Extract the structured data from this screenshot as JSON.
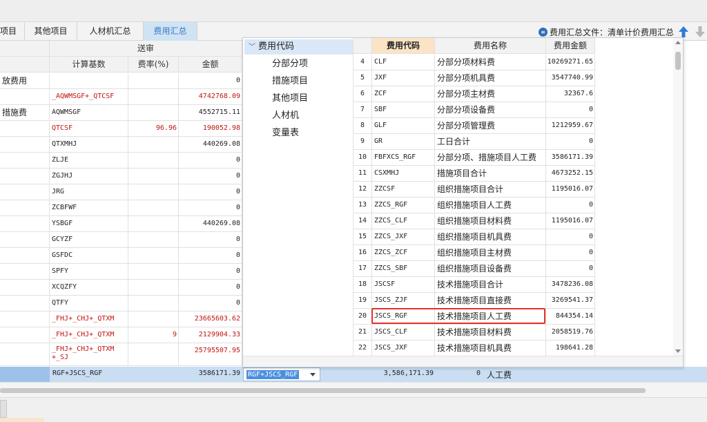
{
  "tabs": [
    {
      "label": "项目"
    },
    {
      "label": "其他项目"
    },
    {
      "label": "人材机汇总"
    },
    {
      "label": "费用汇总",
      "active": true
    }
  ],
  "file_indicator": {
    "icon": "document-icon",
    "label": "费用汇总文件：清单计价费用汇总"
  },
  "left_grid": {
    "group_header": "送审",
    "headers": {
      "basis": "计算基数",
      "rate": "费率(%)",
      "amount": "金额"
    },
    "rows": [
      {
        "name": "放费用",
        "basis": "",
        "rate": "",
        "amount": "0"
      },
      {
        "name": "",
        "basis": "_AQWMSGF+_QTCSF",
        "rate": "",
        "amount": "4742768.09",
        "red": true
      },
      {
        "name": "措施费",
        "basis": "AQWMSGF",
        "rate": "",
        "amount": "4552715.11"
      },
      {
        "name": "",
        "basis": "QTCSF",
        "rate": "96.96",
        "amount": "190052.98",
        "red": true
      },
      {
        "name": "",
        "basis": "QTXMHJ",
        "rate": "",
        "amount": "440269.08"
      },
      {
        "name": "",
        "basis": "ZLJE",
        "rate": "",
        "amount": "0"
      },
      {
        "name": "",
        "basis": "ZGJHJ",
        "rate": "",
        "amount": "0"
      },
      {
        "name": "",
        "basis": "JRG",
        "rate": "",
        "amount": "0"
      },
      {
        "name": "",
        "basis": "ZCBFWF",
        "rate": "",
        "amount": "0"
      },
      {
        "name": "",
        "basis": "YSBGF",
        "rate": "",
        "amount": "440269.08"
      },
      {
        "name": "",
        "basis": "GCYZF",
        "rate": "",
        "amount": "0"
      },
      {
        "name": "",
        "basis": "GSFDC",
        "rate": "",
        "amount": "0"
      },
      {
        "name": "",
        "basis": "SPFY",
        "rate": "",
        "amount": "0"
      },
      {
        "name": "",
        "basis": "XCQZFY",
        "rate": "",
        "amount": "0"
      },
      {
        "name": "",
        "basis": "QTFY",
        "rate": "",
        "amount": "0"
      },
      {
        "name": "",
        "basis": "_FHJ+_CHJ+_QTXM",
        "rate": "",
        "amount": "23665603.62",
        "red": true
      },
      {
        "name": "",
        "basis": "_FHJ+_CHJ+_QTXM",
        "rate": "9",
        "amount": "2129904.33",
        "red": true
      },
      {
        "name": "",
        "basis": "_FHJ+_CHJ+_QTXM\n+_SJ",
        "rate": "",
        "amount": "25795507.95",
        "red": true,
        "tall": true
      }
    ]
  },
  "selected_row": {
    "basis": "RGF+JSCS_RGF",
    "amount": "3586171.39",
    "editor_value": "RGF+JSCS_RGF",
    "right_amount": "3,586,171.39",
    "right_rate": "0",
    "right_name": "人工费"
  },
  "popup": {
    "tree": {
      "root": "费用代码",
      "items": [
        "分部分项",
        "措施项目",
        "其他项目",
        "人材机",
        "变量表"
      ]
    },
    "table": {
      "headers": {
        "num": "",
        "code": "费用代码",
        "name": "费用名称",
        "amount": "费用金额"
      },
      "rows": [
        {
          "num": "4",
          "code": "CLF",
          "name": "分部分项材料费",
          "amount": "10269271.65"
        },
        {
          "num": "5",
          "code": "JXF",
          "name": "分部分项机具费",
          "amount": "3547740.99"
        },
        {
          "num": "6",
          "code": "ZCF",
          "name": "分部分项主材费",
          "amount": "32367.6"
        },
        {
          "num": "7",
          "code": "SBF",
          "name": "分部分项设备费",
          "amount": "0"
        },
        {
          "num": "8",
          "code": "GLF",
          "name": "分部分项管理费",
          "amount": "1212959.67"
        },
        {
          "num": "9",
          "code": "GR",
          "name": "工日合计",
          "amount": "0"
        },
        {
          "num": "10",
          "code": "FBFXCS_RGF",
          "name": "分部分项、措施项目人工费",
          "amount": "3586171.39"
        },
        {
          "num": "11",
          "code": "CSXMHJ",
          "name": "措施项目合计",
          "amount": "4673252.15"
        },
        {
          "num": "12",
          "code": "ZZCSF",
          "name": "组织措施项目合计",
          "amount": "1195016.07"
        },
        {
          "num": "13",
          "code": "ZZCS_RGF",
          "name": "组织措施项目人工费",
          "amount": "0"
        },
        {
          "num": "14",
          "code": "ZZCS_CLF",
          "name": "组织措施项目材料费",
          "amount": "1195016.07"
        },
        {
          "num": "15",
          "code": "ZZCS_JXF",
          "name": "组织措施项目机具费",
          "amount": "0"
        },
        {
          "num": "16",
          "code": "ZZCS_ZCF",
          "name": "组织措施项目主材费",
          "amount": "0"
        },
        {
          "num": "17",
          "code": "ZZCS_SBF",
          "name": "组织措施项目设备费",
          "amount": "0"
        },
        {
          "num": "18",
          "code": "JSCSF",
          "name": "技术措施项目合计",
          "amount": "3478236.08"
        },
        {
          "num": "19",
          "code": "JSCS_ZJF",
          "name": "技术措施项目直接费",
          "amount": "3269541.37"
        },
        {
          "num": "20",
          "code": "JSCS_RGF",
          "name": "技术措施项目人工费",
          "amount": "844354.14",
          "highlight": true
        },
        {
          "num": "21",
          "code": "JSCS_CLF",
          "name": "技术措施项目材料费",
          "amount": "2058519.76"
        },
        {
          "num": "22",
          "code": "JSCS_JXF",
          "name": "技术措施项目机具费",
          "amount": "198641.28"
        }
      ]
    }
  },
  "colors": {
    "active_tab_bg": "#cfe3f5",
    "active_tab_text": "#3a79bd",
    "highlight_border": "#e5302b",
    "red_text": "#c0140f",
    "selected_row_bg": "#c9ddf3",
    "arrow_up": "#2e7bd6",
    "arrow_down": "#b8b8b8"
  }
}
